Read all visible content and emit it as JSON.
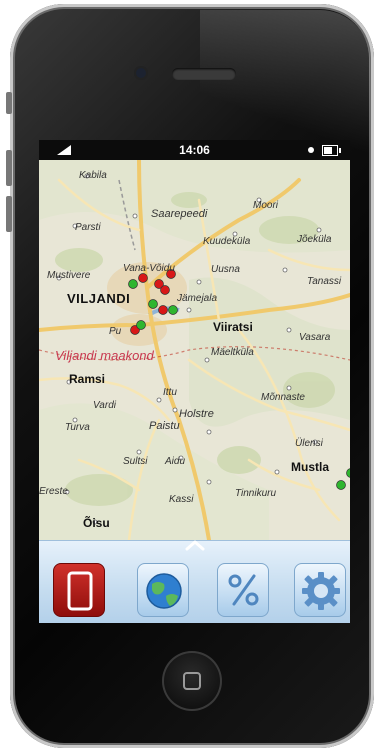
{
  "status_bar": {
    "time": "14:06",
    "signal_icon": "signal-icon",
    "battery_icon": "battery-icon"
  },
  "map": {
    "place_labels": {
      "kabila": "Kabila",
      "parsti": "Parsti",
      "saarepeedi": "Saarepeedi",
      "moori": "Moori",
      "kuudekula": "Kuudeküla",
      "joekula": "Jõeküla",
      "mustivere": "Mustivere",
      "vana_vardu": "Vana-Võidu",
      "uusna": "Uusna",
      "tanassi": "Tanassi",
      "viljandi": "VILJANDI",
      "jamejala": "Jämejala",
      "viiratsi": "Viiratsi",
      "vasara": "Vasara",
      "pu": "Pu",
      "maeltkula": "Mäeltküla",
      "region": "Viljandi maakond",
      "ramsi": "Ramsi",
      "vardi": "Vardi",
      "ittu": "Ittu",
      "monnaste": "Mõnnaste",
      "turva": "Turva",
      "paistu": "Paistu",
      "holstre": "Holstre",
      "ulensi": "Ülensi",
      "sultsi": "Sultsi",
      "aidu": "Aidu",
      "mustla": "Mustla",
      "ereste": "Ereste",
      "tinnikuru": "Tinnikuru",
      "kassi": "Kassi",
      "oisu": "Õisu"
    },
    "markers": {
      "red": "#d81818",
      "green": "#2fb52f"
    }
  },
  "toolbar": {
    "expand_icon": "chevron-up-icon",
    "buttons": [
      {
        "icon": "phone-icon"
      },
      {
        "icon": "globe-icon"
      },
      {
        "icon": "percent-icon"
      },
      {
        "icon": "gear-icon"
      }
    ]
  },
  "colors": {
    "toolbar_bg": "#c5dcef",
    "phone_button": "#c62a24",
    "region_label": "#c8384f"
  }
}
